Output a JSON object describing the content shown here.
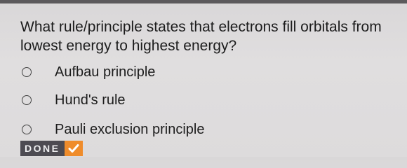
{
  "question": {
    "text": "What rule/principle states that electrons fill orbitals from lowest energy to highest energy?"
  },
  "options": [
    {
      "label": "Aufbau principle",
      "selected": false
    },
    {
      "label": "Hund's rule",
      "selected": false
    },
    {
      "label": "Pauli exclusion principle",
      "selected": false
    }
  ],
  "done_button": {
    "label": "DONE",
    "icon": "checkmark-icon"
  },
  "colors": {
    "background": "#dcdadb",
    "done_bg": "#4d4b52",
    "check_bg": "#ef8c2b"
  }
}
